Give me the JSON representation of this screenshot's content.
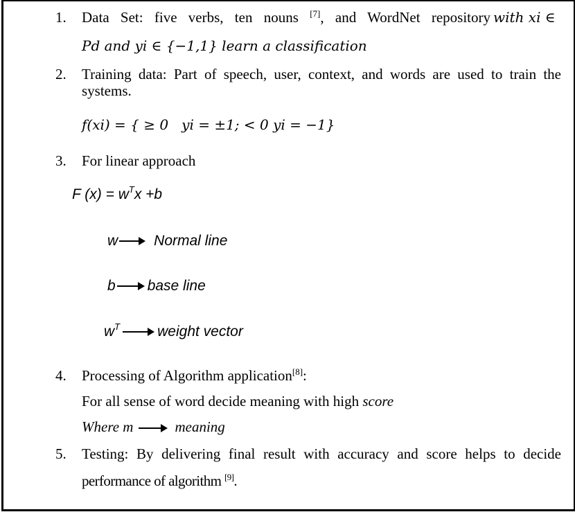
{
  "items": [
    {
      "number": "1.",
      "line1_text": "Data Set: five verbs, ten nouns ",
      "line1_ref": "[7]",
      "line1_after": ", and WordNet repository ",
      "line1_math": "with xi ∈",
      "line2_math": "Pd and yi ∈ {−1,1} learn a classification"
    },
    {
      "number": "2.",
      "line1_text": "Training data: Part of speech, user, context, and words are used to train the",
      "line2_text": "systems.",
      "formula": "f(xi) = { ≥ 0   yi = ±1; < 0 yi = −1}"
    },
    {
      "number": "3.",
      "text": "For linear approach",
      "formula_lhs": "F (x) = w",
      "formula_sup": "T",
      "formula_rhs": "x +b",
      "definitions": [
        {
          "symbol": "w",
          "symbol_sup": "",
          "meaning": "Normal line"
        },
        {
          "symbol": "b",
          "symbol_sup": "",
          "meaning": "base line"
        },
        {
          "symbol": "w",
          "symbol_sup": "T",
          "meaning": "weight vector"
        }
      ]
    },
    {
      "number": "4.",
      "line1_text": "Processing of Algorithm application",
      "line1_ref": "[8]",
      "line1_after": ":",
      "line2_text": "For all sense of word decide meaning with high ",
      "line2_italic": "score",
      "line3_lhs": "Where m",
      "line3_rhs": "meaning"
    },
    {
      "number": "5.",
      "line1_text": "Testing: By delivering final result with accuracy and score helps to decide",
      "line2_text": "performance of algorithm ",
      "line2_ref": "[9]",
      "line2_after": "."
    }
  ]
}
